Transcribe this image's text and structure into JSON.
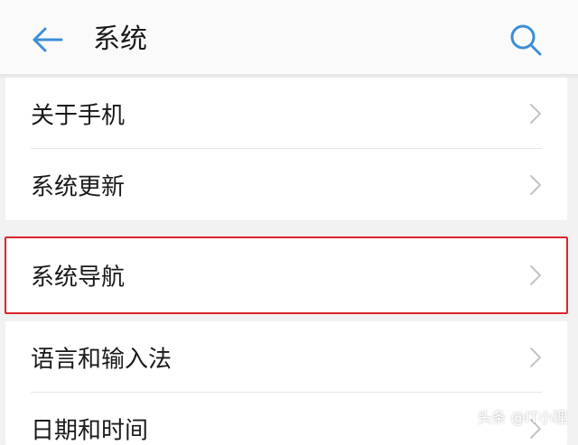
{
  "header": {
    "title": "系统",
    "back_icon": "arrow-left-icon",
    "search_icon": "search-icon",
    "accent_color": "#3d8fd6"
  },
  "items": [
    {
      "label": "关于手机",
      "icon": "chevron-right-icon"
    },
    {
      "label": "系统更新",
      "icon": "chevron-right-icon"
    },
    {
      "label": "系统导航",
      "icon": "chevron-right-icon",
      "highlighted": true
    },
    {
      "label": "语言和输入法",
      "icon": "chevron-right-icon"
    },
    {
      "label": "日期和时间",
      "icon": "chevron-right-icon"
    }
  ],
  "highlight_color": "#d9262c",
  "watermark": "头条 @IT小理"
}
